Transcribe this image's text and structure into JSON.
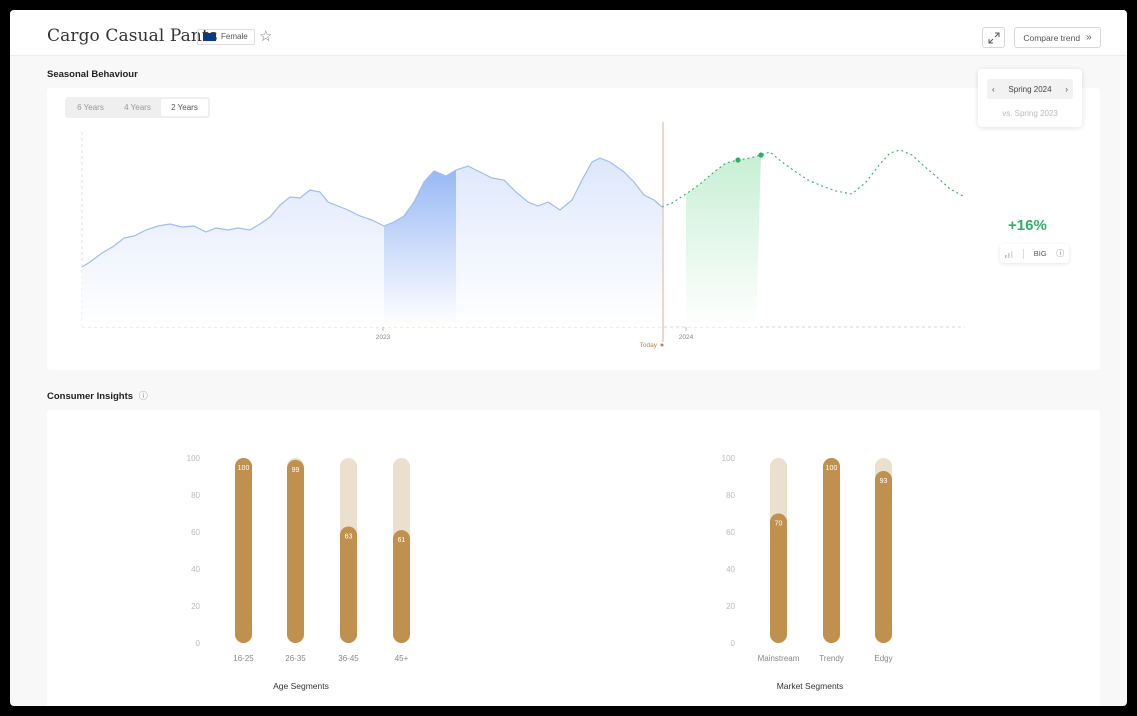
{
  "header": {
    "title": "Cargo Casual Pants",
    "gender_label": "Female",
    "compare_label": "Compare trend",
    "compare_icon": "chevrons-right-icon",
    "star_icon": "star-icon",
    "expand_icon": "expand-icon"
  },
  "seasonal": {
    "section_title": "Seasonal Behaviour",
    "range_tabs": [
      "6 Years",
      "4 Years",
      "2 Years"
    ],
    "active_tab": "2 Years",
    "season_selected": "Spring 2024",
    "season_compare": "vs. Spring 2023",
    "change_pct": "+16%",
    "size_label": "BIG",
    "today_label": "Today",
    "year_labels": [
      "2023",
      "2024"
    ],
    "colors": {
      "past_fill": "#e2ebfd",
      "past_line": "#9ebdf1",
      "highlight": "#a9c4f7",
      "forecast": "#2fb068",
      "forecast_fill": "#d4f3de",
      "today_line": "#c9a07a"
    }
  },
  "consumer": {
    "section_title": "Consumer Insights",
    "info_icon": "info-icon"
  },
  "chart_data": [
    {
      "type": "bar",
      "title": "Age Segments",
      "categories": [
        "16-25",
        "26-35",
        "36-45",
        "45+"
      ],
      "values": [
        100,
        99,
        63,
        61
      ],
      "ylim": [
        0,
        100
      ],
      "yticks": [
        0,
        20,
        40,
        60,
        80,
        100
      ],
      "colors": {
        "bar": "#c0904f",
        "track": "#ebdfce"
      }
    },
    {
      "type": "bar",
      "title": "Market Segments",
      "categories": [
        "Mainstream",
        "Trendy",
        "Edgy"
      ],
      "values": [
        70,
        100,
        93
      ],
      "ylim": [
        0,
        100
      ],
      "yticks": [
        0,
        20,
        40,
        60,
        80,
        100
      ],
      "colors": {
        "bar": "#c0904f",
        "track": "#ebdfce"
      }
    }
  ]
}
